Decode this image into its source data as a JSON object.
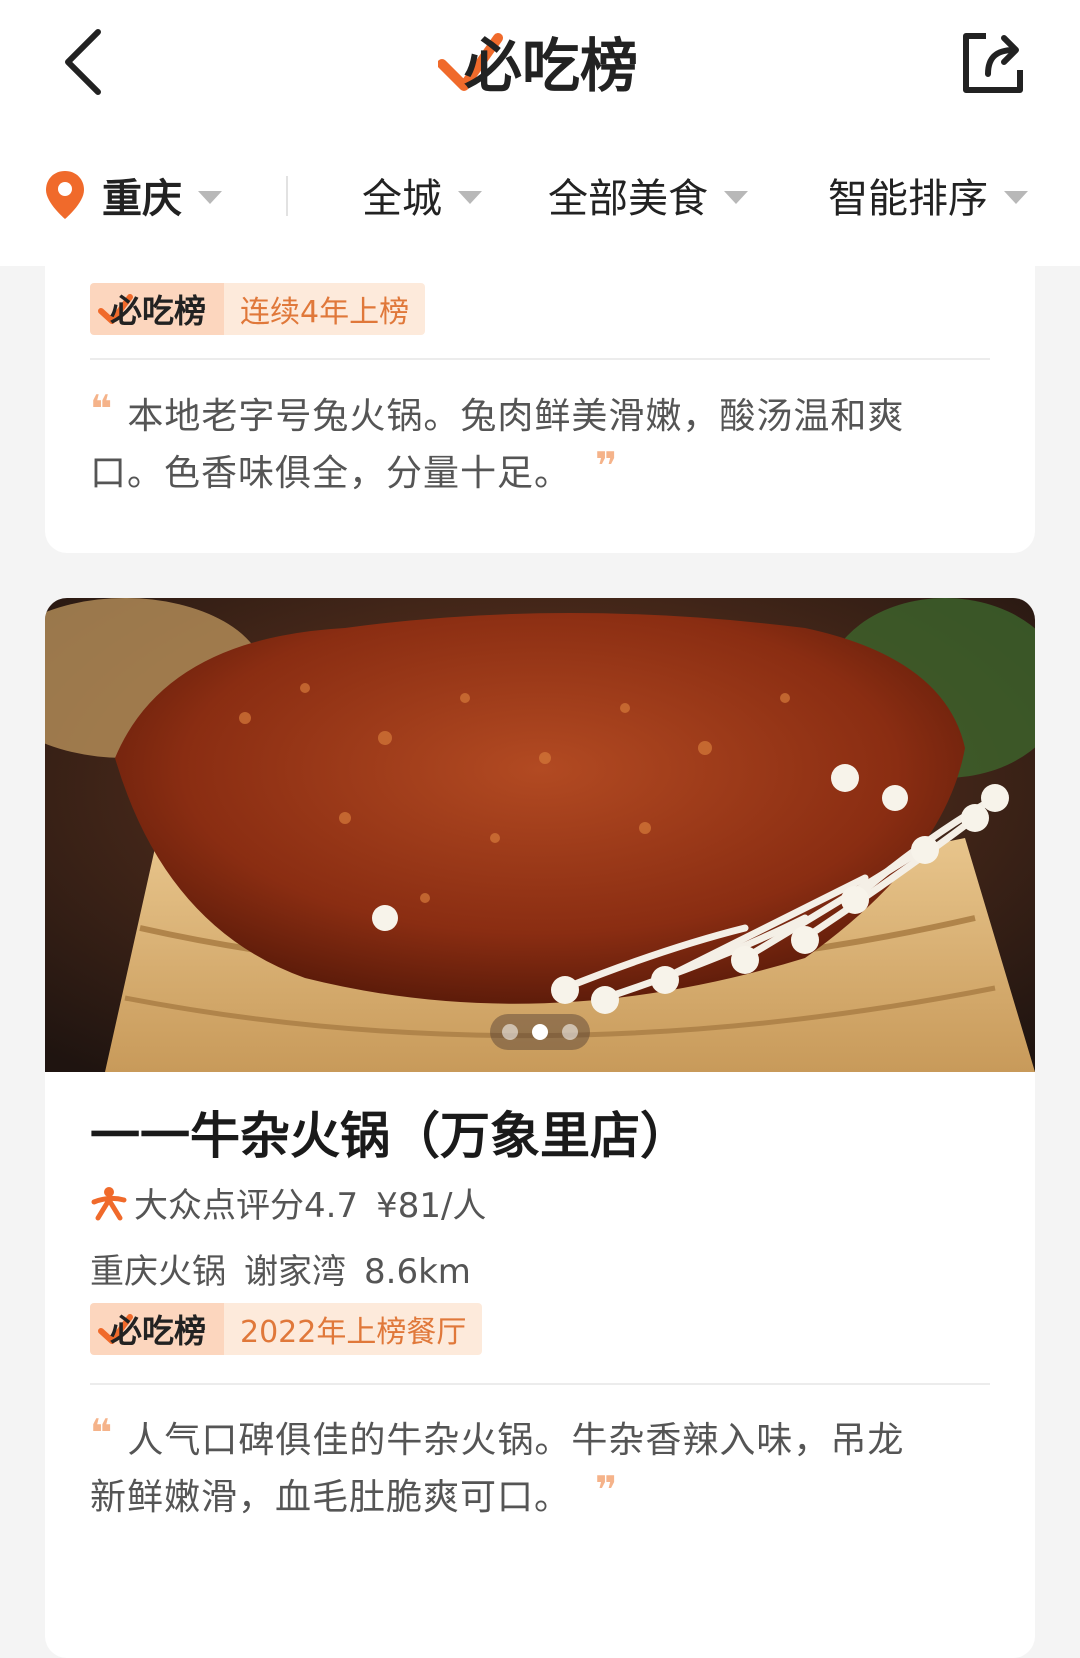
{
  "header": {
    "logo_text": "必吃榜",
    "back_icon": "chevron-left-icon",
    "share_icon": "share-icon"
  },
  "filters": {
    "city": "重庆",
    "area": "全城",
    "category": "全部美食",
    "sort": "智能排序"
  },
  "cards": [
    {
      "badge_logo": "必吃榜",
      "badge_text": "连续4年上榜",
      "quote_line1": "本地老字号兔火锅。兔肉鲜美滑嫩，酸汤温和爽",
      "quote_line2": "口。色香味俱全，分量十足。"
    },
    {
      "title": "一一牛杂火锅（万象里店）",
      "rating_label": "大众点评分4.7",
      "price": "¥81/人",
      "cuisine": "重庆火锅",
      "district": "谢家湾",
      "distance": "8.6km",
      "badge_logo": "必吃榜",
      "badge_text": "2022年上榜餐厅",
      "quote_line1": "人气口碑俱佳的牛杂火锅。牛杂香辣入味，吊龙",
      "quote_line2": "新鲜嫩滑，血毛肚脆爽可口。",
      "carousel": {
        "total": 3,
        "active": 2
      }
    }
  ],
  "colors": {
    "brand_orange": "#f06a2b",
    "badge_text": "#e0783a",
    "quote_mark": "#f5b38a"
  }
}
